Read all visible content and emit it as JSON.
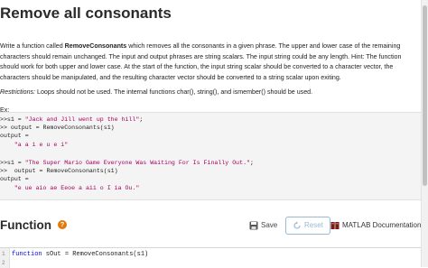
{
  "problem": {
    "title": "Remove all consonants",
    "desc_pre": "Write a function called ",
    "desc_fn": "RemoveConsonants",
    "desc_post": " which removes all the consonants in a given phrase.  The upper and lower case of the remaining characters should remain unchanged. The input and output phrases are string scalars. The input string could be any length. Hint: The function should work for both upper and lower case.  At the start of the function, the input string scalar should be converted to a character vector, the characters should be manipulated, and the resulting character vector should be converted to a string scalar upon exiting.",
    "restrictions_label": "Restrictions:",
    "restrictions_text": "  Loops should not be used.  The internal functions char(), string(), and ismember() should be used.",
    "ex_label": "Ex:",
    "code_lines": [
      {
        "pre": ">>s1 = ",
        "str": "\"Jack and Jill went up the hill\"",
        "post": ";"
      },
      {
        "pre": ">> output = RemoveConsonants(s1)",
        "str": "",
        "post": ""
      },
      {
        "pre": "output =",
        "str": "",
        "post": ""
      },
      {
        "pre": "    ",
        "str": "\"a a i e u e i\"",
        "post": ""
      },
      {
        "pre": ">>s1 = ",
        "str": "\"The Super Mario Game Everyone Was Waiting For Is Finally Out.\"",
        "post": ";"
      },
      {
        "pre": ">>  output = RemoveConsonants(s1)",
        "str": "",
        "post": ""
      },
      {
        "pre": "output =",
        "str": "",
        "post": ""
      },
      {
        "pre": "    ",
        "str": "\"e ue aio ae Eeoe a aii o I ia Ou.\"",
        "post": ""
      }
    ]
  },
  "function_section": {
    "title": "Function",
    "help_icon": "?",
    "save_label": "Save",
    "reset_label": "Reset",
    "doc_label": "MATLAB Documentation"
  },
  "editor": {
    "lines": [
      {
        "num": "1",
        "kw": "function",
        "text": " sOut = RemoveConsonants(s1)"
      },
      {
        "num": "2",
        "kw": "",
        "text": ""
      }
    ]
  }
}
